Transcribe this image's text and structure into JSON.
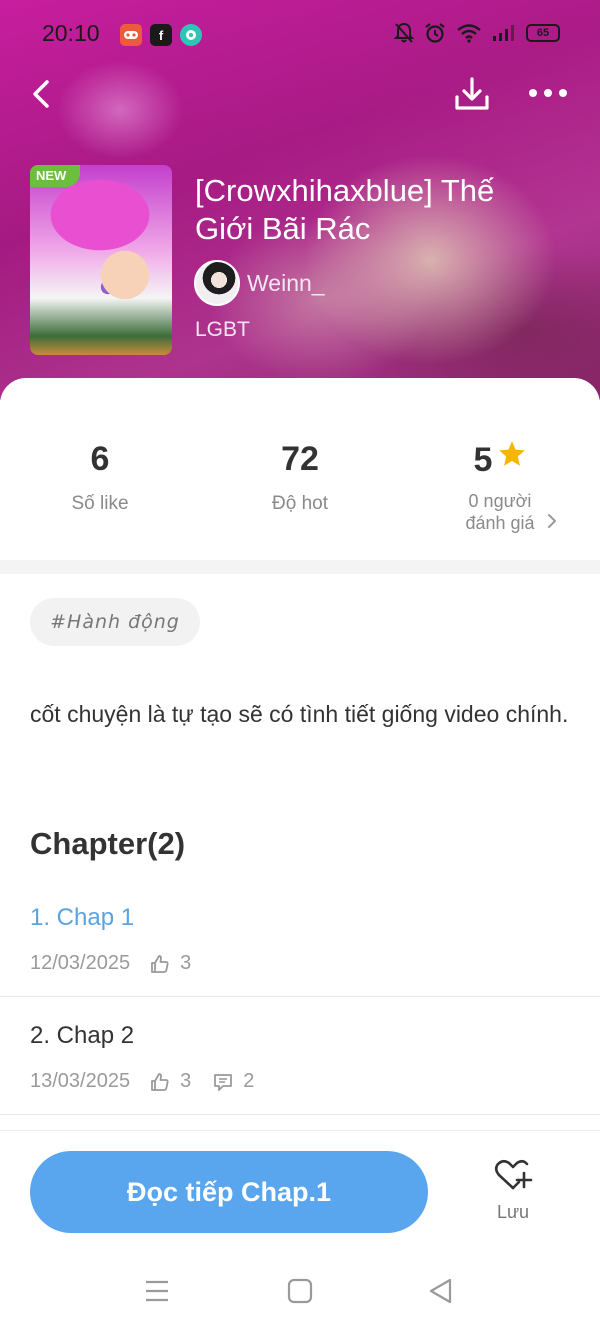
{
  "status_bar": {
    "time": "20:10",
    "battery": "65"
  },
  "topbar": {
    "back_icon": "chevron-left-icon",
    "download_icon": "download-icon",
    "more_icon": "more-dots-icon"
  },
  "story": {
    "badge": "NEW",
    "title": "[Crowxhihaxblue] Thế Giới Bãi Rác",
    "author": "Weinn_",
    "genre": "LGBT"
  },
  "stats": {
    "likes_value": "6",
    "likes_label": "Số like",
    "hot_value": "72",
    "hot_label": "Độ hot",
    "rating_value": "5",
    "rating_label_line1": "0 người",
    "rating_label_line2": "đánh giá"
  },
  "tag": "#Hành động",
  "description": "cốt chuyện là tự tạo sẽ có tình tiết giống video chính.",
  "chapters_heading": "Chapter(2)",
  "chapters": [
    {
      "title": "1. Chap 1",
      "date": "12/03/2025",
      "likes": "3"
    },
    {
      "title": "2. Chap 2",
      "date": "13/03/2025",
      "likes": "3",
      "comments": "2"
    }
  ],
  "bottom": {
    "read_label": "Đọc tiếp Chap.1",
    "save_label": "Lưu"
  },
  "colors": {
    "accent": "#5aa6ee",
    "chapter_active": "#5ba3e0",
    "star": "#f7b500",
    "new_badge": "#6bbf3c"
  }
}
